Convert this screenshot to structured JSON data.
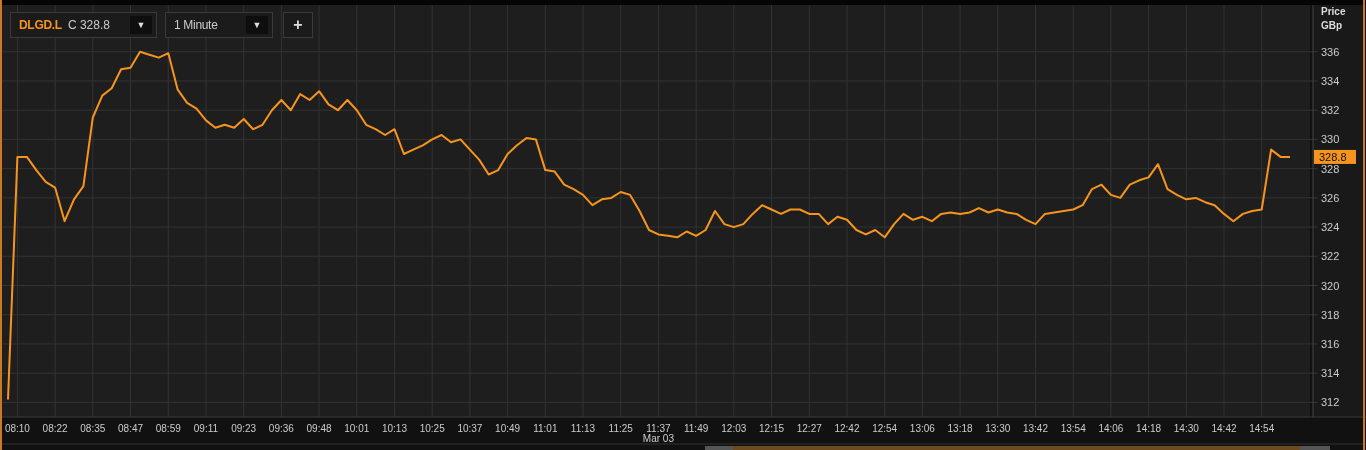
{
  "toolbar": {
    "symbol": "DLGD.L",
    "quote": "C 328.8",
    "symbol_caret": "▼",
    "interval": "1 Minute",
    "interval_caret": "▼",
    "add_button": "+"
  },
  "chart": {
    "price_label": "Price",
    "unit_label": "GBp",
    "last_price": "328.8",
    "date_label": "Mar 03",
    "chart_data": {
      "type": "line",
      "grid": true,
      "ylim": [
        311,
        339.2
      ],
      "yticks": [
        312,
        314,
        316,
        318,
        320,
        322,
        324,
        326,
        328,
        330,
        332,
        334,
        336
      ],
      "categories": [
        null,
        "08:10",
        null,
        null,
        null,
        "08:22",
        null,
        null,
        null,
        "08:35",
        null,
        null,
        null,
        "08:47",
        null,
        null,
        null,
        "08:59",
        null,
        null,
        null,
        "09:11",
        null,
        null,
        null,
        "09:23",
        null,
        null,
        null,
        "09:36",
        null,
        null,
        null,
        "09:48",
        null,
        null,
        null,
        "10:01",
        null,
        null,
        null,
        "10:13",
        null,
        null,
        null,
        "10:25",
        null,
        null,
        null,
        "10:37",
        null,
        null,
        null,
        "10:49",
        null,
        null,
        null,
        "11:01",
        null,
        null,
        null,
        "11:13",
        null,
        null,
        null,
        "11:25",
        null,
        null,
        null,
        "11:37",
        null,
        null,
        null,
        "11:49",
        null,
        null,
        null,
        "12:03",
        null,
        null,
        null,
        "12:15",
        null,
        null,
        null,
        "12:27",
        null,
        null,
        null,
        "12:42",
        null,
        null,
        null,
        "12:54",
        null,
        null,
        null,
        "13:06",
        null,
        null,
        null,
        "13:18",
        null,
        null,
        null,
        "13:30",
        null,
        null,
        null,
        "13:42",
        null,
        null,
        null,
        "13:54",
        null,
        null,
        null,
        "14:06",
        null,
        null,
        null,
        "14:18",
        null,
        null,
        null,
        "14:30",
        null,
        null,
        null,
        "14:42",
        null,
        null,
        null,
        "14:54",
        null,
        null,
        null
      ],
      "series": [
        {
          "color": "#f7941d",
          "values": [
            312.2,
            328.8,
            328.8,
            327.9,
            327.1,
            326.7,
            324.4,
            325.9,
            326.8,
            331.5,
            333.0,
            333.5,
            334.8,
            334.9,
            336.0,
            335.8,
            335.6,
            335.9,
            333.4,
            332.5,
            332.1,
            331.3,
            330.8,
            331.0,
            330.8,
            331.4,
            330.7,
            331.0,
            332.0,
            332.7,
            332.0,
            333.1,
            332.7,
            333.3,
            332.4,
            332.0,
            332.7,
            332.0,
            331.0,
            330.7,
            330.3,
            330.7,
            329.0,
            329.3,
            329.6,
            330.0,
            330.3,
            329.8,
            330.0,
            329.3,
            328.6,
            327.6,
            327.9,
            329.0,
            329.6,
            330.1,
            330.0,
            327.9,
            327.8,
            326.9,
            326.6,
            326.2,
            325.5,
            325.9,
            326.0,
            326.4,
            326.2,
            325.1,
            323.8,
            323.5,
            323.4,
            323.3,
            323.7,
            323.4,
            323.8,
            325.1,
            324.2,
            324.0,
            324.2,
            324.9,
            325.5,
            325.2,
            324.9,
            325.2,
            325.2,
            324.9,
            324.9,
            324.2,
            324.7,
            324.5,
            323.8,
            323.5,
            323.8,
            323.3,
            324.2,
            324.9,
            324.5,
            324.7,
            324.4,
            324.9,
            325.0,
            324.9,
            325.0,
            325.3,
            325.0,
            325.2,
            325.0,
            324.9,
            324.5,
            324.2,
            324.9,
            325.0,
            325.1,
            325.2,
            325.5,
            326.6,
            326.9,
            326.2,
            326.0,
            326.9,
            327.2,
            327.4,
            328.3,
            326.6,
            326.2,
            325.9,
            326.0,
            325.7,
            325.5,
            324.9,
            324.4,
            324.9,
            325.1,
            325.2,
            329.3,
            328.8,
            328.8
          ]
        }
      ]
    }
  }
}
